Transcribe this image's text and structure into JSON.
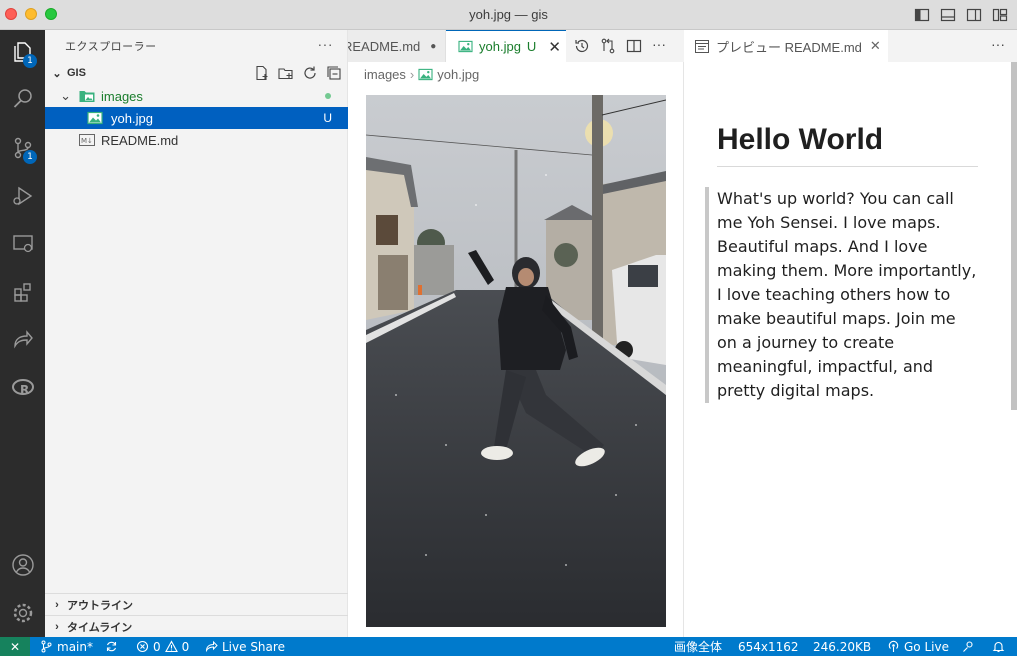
{
  "window": {
    "title": "yoh.jpg — gis"
  },
  "activity_bar": {
    "items": [
      {
        "icon": "explorer-icon",
        "badge": "1"
      },
      {
        "icon": "search-icon"
      },
      {
        "icon": "source-control-icon",
        "badge": "1"
      },
      {
        "icon": "run-debug-icon"
      },
      {
        "icon": "remote-explorer-icon"
      },
      {
        "icon": "extensions-icon"
      },
      {
        "icon": "live-share-icon"
      },
      {
        "icon": "r-language-icon"
      },
      {
        "icon": "account-icon"
      },
      {
        "icon": "settings-gear-icon"
      }
    ]
  },
  "sidebar": {
    "header": "エクスプローラー",
    "more": "···",
    "workspace": "GIS",
    "tree": [
      {
        "label": "images",
        "type": "folder",
        "status_dot": true
      },
      {
        "label": "yoh.jpg",
        "type": "image",
        "status": "U",
        "selected": true
      },
      {
        "label": "README.md",
        "type": "markdown"
      }
    ],
    "outline_label": "アウトライン",
    "timeline_label": "タイムライン"
  },
  "editor1": {
    "tabs": [
      {
        "label": "README.md",
        "dirty": true
      },
      {
        "label": "yoh.jpg",
        "status": "U",
        "active": true
      }
    ],
    "breadcrumb": {
      "folder": "images",
      "file": "yoh.jpg"
    },
    "more": "···"
  },
  "preview": {
    "tab_label": "プレビュー README.md",
    "heading": "Hello World",
    "quote": "What's up world? You can call me Yoh Sensei. I love maps. Beautiful maps. And I love making them. More importantly, I love teaching others how to make beautiful maps. Join me on a journey to create meaningful, impactful, and pretty digital maps.",
    "more": "···"
  },
  "status_bar": {
    "branch": "main*",
    "errors": "0",
    "warnings": "0",
    "live_share": "Live Share",
    "zoom": "画像全体",
    "dimensions": "654x1162",
    "file_size": "246.20KB",
    "go_live": "Go Live"
  },
  "colors": {
    "accent": "#007acc",
    "selection": "#0060c0",
    "untracked": "#1a7d2c",
    "activity_bar": "#2c2c2c"
  }
}
